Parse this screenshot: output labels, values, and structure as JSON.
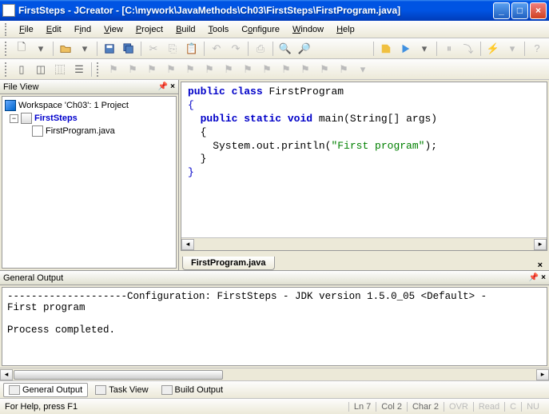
{
  "titlebar": {
    "text": "FirstSteps - JCreator - [C:\\mywork\\JavaMethods\\Ch03\\FirstSteps\\FirstProgram.java]"
  },
  "menu": {
    "file": "File",
    "edit": "Edit",
    "find": "Find",
    "view": "View",
    "project": "Project",
    "build": "Build",
    "tools": "Tools",
    "configure": "Configure",
    "window": "Window",
    "help": "Help"
  },
  "fileview": {
    "title": "File View",
    "workspace": "Workspace 'Ch03': 1 Project",
    "project": "FirstSteps",
    "file": "FirstProgram.java"
  },
  "editor": {
    "tab": "FirstProgram.java",
    "code": {
      "l1_kw1": "public",
      "l1_kw2": "class",
      "l1_name": " FirstProgram",
      "l2": "{",
      "l3_kw1": "public",
      "l3_kw2": "static",
      "l3_kw3": "void",
      "l3_rest": " main(String[] args)",
      "l4": "  {",
      "l5a": "    System.out.println(",
      "l5str": "\"First program\"",
      "l5b": ");",
      "l6": "  }",
      "l7": "}"
    }
  },
  "output": {
    "title": "General Output",
    "text": "--------------------Configuration: FirstSteps - JDK version 1.5.0_05 <Default> - \nFirst program\n\nProcess completed."
  },
  "bottom_tabs": {
    "general": "General Output",
    "task": "Task View",
    "build": "Build Output"
  },
  "status": {
    "hint": "For Help, press F1",
    "ln": "Ln 7",
    "col": "Col 2",
    "char": "Char 2",
    "ovr": "OVR",
    "read": "Read",
    "c": "C",
    "num": "NU"
  }
}
